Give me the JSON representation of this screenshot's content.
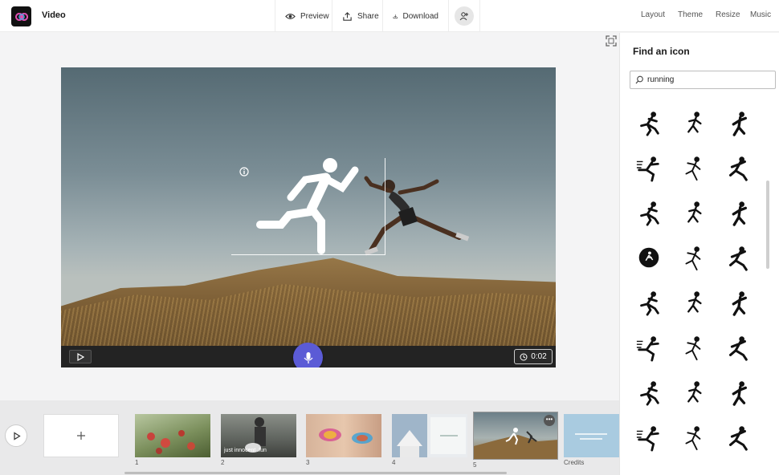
{
  "app": {
    "title": "Video"
  },
  "toolbar": {
    "preview": "Preview",
    "share": "Share",
    "download": "Download"
  },
  "right_menu": {
    "layout": "Layout",
    "theme": "Theme",
    "resize": "Resize",
    "music": "Music"
  },
  "player": {
    "time": "0:02"
  },
  "panel": {
    "title": "Find an icon",
    "search_value": "running"
  },
  "icons": [
    "runner-dash-icon",
    "runner-small-icon",
    "runner-stroller-icon",
    "sprinter-icon",
    "runner-speed-lines-icon",
    "runner-rain-icon",
    "runner-stride-icon",
    "runner-striped-icon",
    "runner-crouch-icon",
    "runner-circle-badge-icon",
    "runner-slim-icon",
    "runner-storm-icon",
    "runner-female-icon",
    "runner-kid-icon",
    "runner-bold-icon",
    "runner-leap-icon",
    "runner-lean-icon",
    "runner-fast-icon",
    "runner-jog-icon",
    "runner-dynamic-icon",
    "runner-sketch-icon",
    "runner-walk-icon",
    "runner-sprint-icon",
    "runner-doodle-icon"
  ],
  "timeline": {
    "scenes": [
      {
        "number": "1",
        "caption": ""
      },
      {
        "number": "2",
        "caption": "just innocent .fun"
      },
      {
        "number": "3",
        "caption": ""
      },
      {
        "number": "4",
        "caption": ""
      },
      {
        "number": "5",
        "caption": ""
      },
      {
        "number": "Credits",
        "caption": ""
      }
    ],
    "more": "•••"
  }
}
